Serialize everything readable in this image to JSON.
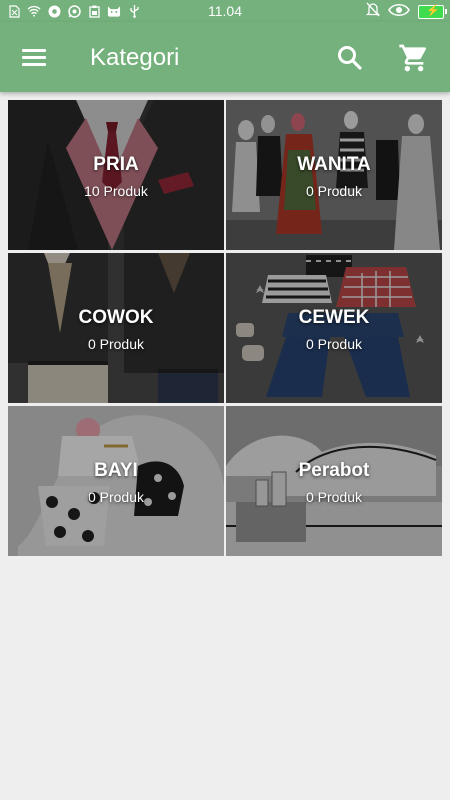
{
  "status_bar": {
    "time": "11.04",
    "icons": [
      "sim-off-icon",
      "wifi-icon",
      "chrome-icon",
      "whatsapp-icon",
      "clipboard-icon",
      "cat-icon",
      "usb-icon"
    ],
    "right_icons": [
      "mute-bell-icon",
      "eye-icon",
      "battery-charging-icon"
    ]
  },
  "appbar": {
    "title": "Kategori",
    "color": "#74b17c"
  },
  "categories": [
    {
      "name": "PRIA",
      "count": "10 Produk",
      "image": "menswear-suit-photo"
    },
    {
      "name": "WANITA",
      "count": "0 Produk",
      "image": "mannequins-dresses-photo"
    },
    {
      "name": "COWOK",
      "count": "0 Produk",
      "image": "boys-blazer-photo"
    },
    {
      "name": "CEWEK",
      "count": "0 Produk",
      "image": "girls-outfit-flatlay-photo"
    },
    {
      "name": "BAYI",
      "count": "0 Produk",
      "image": "baby-clothes-photo"
    },
    {
      "name": "Perabot",
      "count": "0 Produk",
      "image": "bedroom-furniture-photo"
    }
  ]
}
